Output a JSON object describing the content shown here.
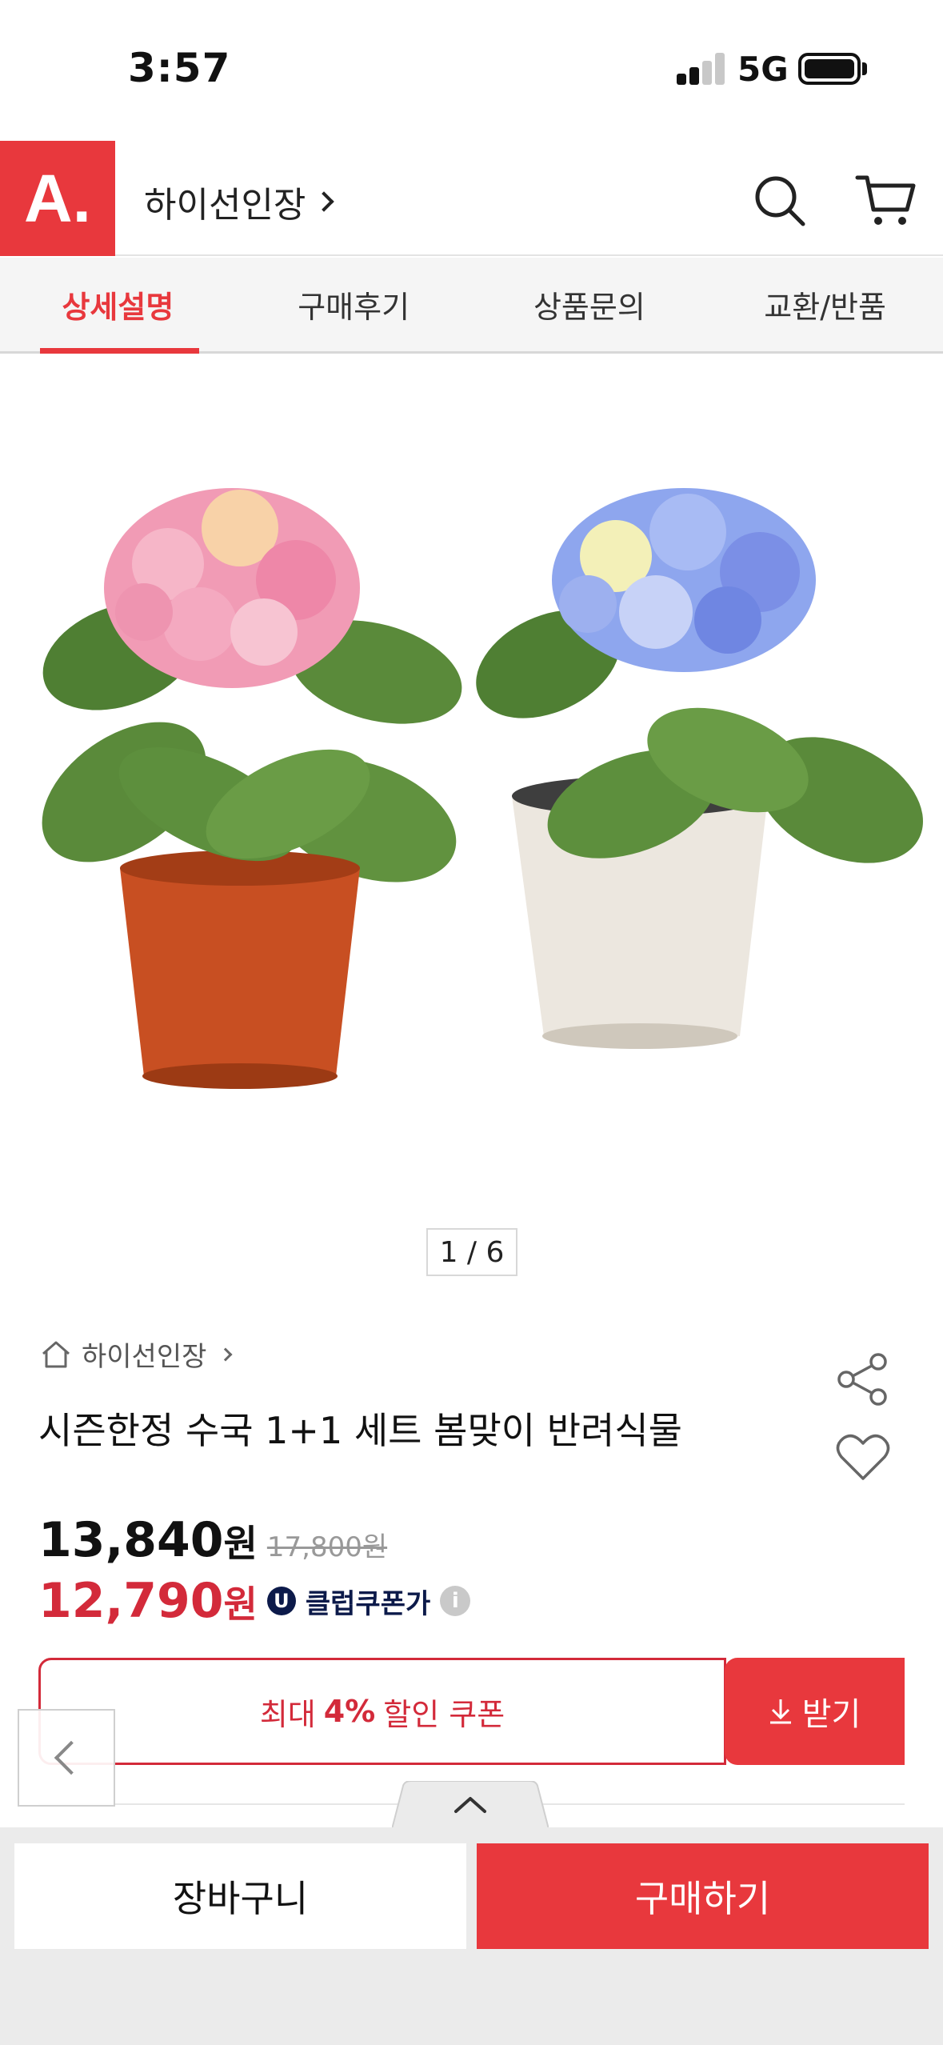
{
  "status": {
    "time": "3:57",
    "network": "5G"
  },
  "header": {
    "logo_text": "A.",
    "store_name": "하이선인장"
  },
  "tabs": [
    {
      "label": "상세설명",
      "active": true
    },
    {
      "label": "구매후기",
      "active": false
    },
    {
      "label": "상품문의",
      "active": false
    },
    {
      "label": "교환/반품",
      "active": false
    }
  ],
  "gallery": {
    "pager": "1 / 6"
  },
  "product": {
    "store": "하이선인장",
    "title": "시즌한정 수국 1+1  세트 봄맞이 반려식물",
    "price": "13,840",
    "price_unit": "원",
    "original_price": "17,800원",
    "coupon_price": "12,790",
    "coupon_price_unit": "원",
    "club_badge": "U",
    "club_label": "클럽쿠폰가",
    "info_icon": "i"
  },
  "coupon": {
    "prefix": "최대",
    "percent": "4%",
    "suffix": "할인 쿠폰",
    "button": "받기"
  },
  "bottom": {
    "cart": "장바구니",
    "buy": "구매하기"
  },
  "colors": {
    "accent": "#e8383d",
    "coupon_red": "#d32a3a",
    "club_navy": "#0c1a4a"
  }
}
